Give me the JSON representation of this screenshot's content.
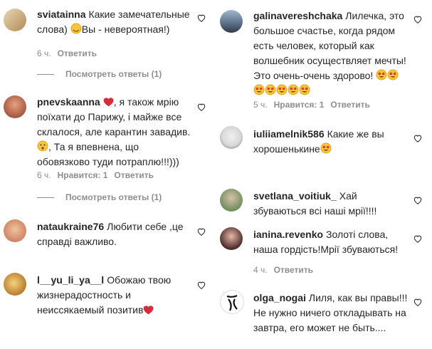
{
  "left": [
    {
      "user": "sviatainna",
      "text": "Какие замечательные слова)",
      "text2": "Вы - невероятная!)",
      "time": "6 ч.",
      "reply": "Ответить",
      "view_replies": "Посмотреть ответы (1)"
    },
    {
      "user": "pnevskaanna",
      "text_a": ", я також мрію поїхати до Парижу, і майже все склалося, але карантин завадив.",
      "text_b": ", Та я впевнена, що обовязково туди потраплю!!!)))",
      "time": "6 ч.",
      "likes": "Нравится: 1",
      "reply": "Ответить",
      "view_replies": "Посмотреть ответы (1)"
    },
    {
      "user": "nataukraine76",
      "text": "Любити себе ,це справді важливо."
    },
    {
      "user": "l__yu_li_ya__l",
      "text": "Обожаю твою жизнерадостность и неиссякаемый позитив"
    }
  ],
  "right": [
    {
      "user": "galinavereshchaka",
      "text": "Лилечка, это большое счастье, когда рядом есть человек, который как волшебник осуществляет мечты! Это очень-очень здорово!",
      "time": "5 ч.",
      "likes": "Нравится: 1",
      "reply": "Ответить"
    },
    {
      "user": "iuliiamelnik586",
      "text": "Какие же вы хорошенькине"
    },
    {
      "user": "svetlana_voitiuk_",
      "text": "Хай збуваються всі наші мрії!!!!"
    },
    {
      "user": "ianina.revenko",
      "text": "Золоті слова, наша гордість!Мрії збуваються!",
      "time": "4 ч.",
      "reply": "Ответить"
    },
    {
      "user": "olga_nogai",
      "text": "Лиля, как вы правы!!! Не нужно ничего откладывать на завтра, его может не быть...."
    }
  ],
  "colors": {
    "text": "#262626",
    "meta": "#8e8e8e",
    "heart": "#ed4956"
  }
}
